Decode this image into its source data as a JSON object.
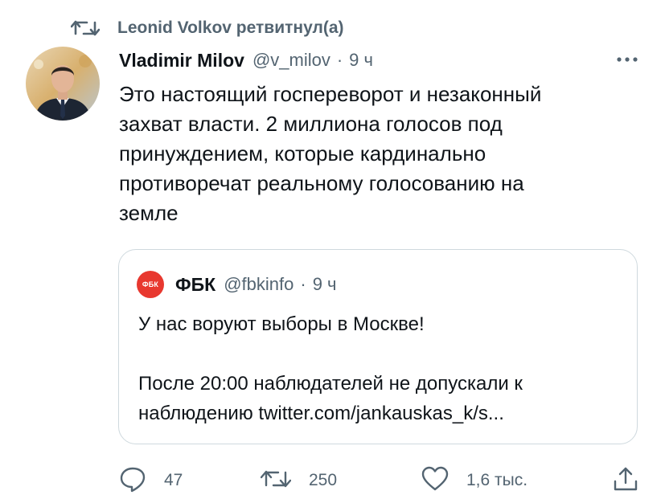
{
  "retweet_banner": {
    "text": "Leonid Volkov ретвитнул(а)"
  },
  "tweet": {
    "author_name": "Vladimir Milov",
    "author_handle": "@v_milov",
    "separator": "·",
    "time": "9 ч",
    "text_lines": [
      "Это настоящий госпереворот и незаконный",
      "захват власти. 2 миллиона голосов под",
      "принуждением, которые кардинально",
      "противоречат реальному голосованию на",
      "земле"
    ]
  },
  "quoted_tweet": {
    "avatar_text": "ФБК",
    "author_name": "ФБК",
    "author_handle": "@fbkinfo",
    "separator": "·",
    "time": "9 ч",
    "text_lines": [
      "У нас воруют выборы в Москве!",
      "",
      "После 20:00 наблюдателей не допускали к",
      "наблюдению twitter.com/jankauskas_k/s..."
    ]
  },
  "actions": {
    "reply_count": "47",
    "retweet_count": "250",
    "like_count": "1,6 тыс.",
    "icons": [
      "reply-icon",
      "retweet-icon",
      "like-icon",
      "share-icon"
    ]
  },
  "colors": {
    "text": "#0f1419",
    "secondary": "#536471",
    "border": "#cfd9de",
    "fbk_red": "#e8382f"
  }
}
